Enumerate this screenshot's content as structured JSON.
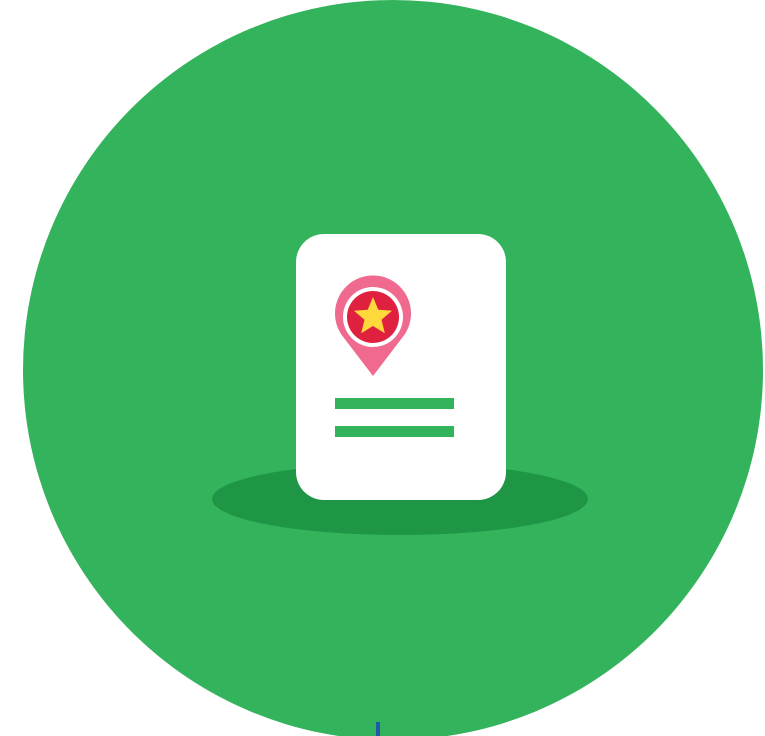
{
  "illustration": {
    "subject": "document-with-location-pin",
    "icons": [
      "document-icon",
      "location-pin-icon",
      "star-icon"
    ],
    "colors": {
      "background_circle": "#33b35b",
      "shadow": "#1f9646",
      "document": "#ffffff",
      "text_lines": "#33b35b",
      "pin_outer": "#f06a8f",
      "pin_ring": "#ffffff",
      "pin_inner": "#e0203f",
      "star": "#ffd93b",
      "bottom_mark": "#1f5aa6"
    }
  }
}
